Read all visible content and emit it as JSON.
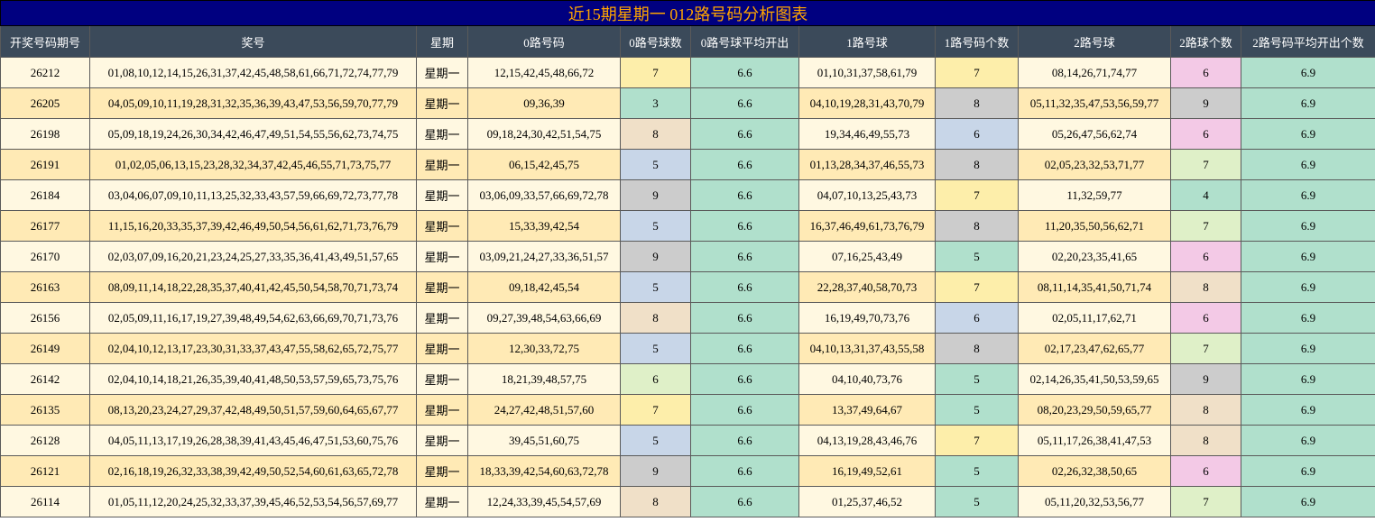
{
  "title": "近15期星期一 012路号码分析图表",
  "headers": [
    "开奖号码期号",
    "奖号",
    "星期",
    "0路号码",
    "0路号球数",
    "0路号球平均开出",
    "1路号球",
    "1路号码个数",
    "2路号球",
    "2路球个数",
    "2路号码平均开出个数"
  ],
  "colors": {
    "7": "#fdeeaa",
    "3": "#b0e0cc",
    "8": "#f0e0c8",
    "5": "#c8d6e8",
    "9": "#cccccc",
    "6": "#dff0c8",
    "4": "#b0e0cc",
    "avg": "#b0e0cc"
  },
  "rows": [
    {
      "issue": "26212",
      "numbers": "01,08,10,12,14,15,26,31,37,42,45,48,58,61,66,71,72,74,77,79",
      "weekday": "星期一",
      "r0": "12,15,42,45,48,66,72",
      "r0n": "7",
      "r0avg": "6.6",
      "r1": "01,10,31,37,58,61,79",
      "r1n": "7",
      "r2": "08,14,26,71,74,77",
      "r2n": "6",
      "r2avg": "6.9",
      "c0": "#fdeeaa",
      "c1": "#fdeeaa",
      "c2": "#f3c9e6"
    },
    {
      "issue": "26205",
      "numbers": "04,05,09,10,11,19,28,31,32,35,36,39,43,47,53,56,59,70,77,79",
      "weekday": "星期一",
      "r0": "09,36,39",
      "r0n": "3",
      "r0avg": "6.6",
      "r1": "04,10,19,28,31,43,70,79",
      "r1n": "8",
      "r2": "05,11,32,35,47,53,56,59,77",
      "r2n": "9",
      "r2avg": "6.9",
      "c0": "#b0e0cc",
      "c1": "#cccccc",
      "c2": "#cccccc"
    },
    {
      "issue": "26198",
      "numbers": "05,09,18,19,24,26,30,34,42,46,47,49,51,54,55,56,62,73,74,75",
      "weekday": "星期一",
      "r0": "09,18,24,30,42,51,54,75",
      "r0n": "8",
      "r0avg": "6.6",
      "r1": "19,34,46,49,55,73",
      "r1n": "6",
      "r2": "05,26,47,56,62,74",
      "r2n": "6",
      "r2avg": "6.9",
      "c0": "#f0e0c8",
      "c1": "#c8d6e8",
      "c2": "#f3c9e6"
    },
    {
      "issue": "26191",
      "numbers": "01,02,05,06,13,15,23,28,32,34,37,42,45,46,55,71,73,75,77",
      "weekday": "星期一",
      "r0": "06,15,42,45,75",
      "r0n": "5",
      "r0avg": "6.6",
      "r1": "01,13,28,34,37,46,55,73",
      "r1n": "8",
      "r2": "02,05,23,32,53,71,77",
      "r2n": "7",
      "r2avg": "6.9",
      "c0": "#c8d6e8",
      "c1": "#cccccc",
      "c2": "#dff0c8"
    },
    {
      "issue": "26184",
      "numbers": "03,04,06,07,09,10,11,13,25,32,33,43,57,59,66,69,72,73,77,78",
      "weekday": "星期一",
      "r0": "03,06,09,33,57,66,69,72,78",
      "r0n": "9",
      "r0avg": "6.6",
      "r1": "04,07,10,13,25,43,73",
      "r1n": "7",
      "r2": "11,32,59,77",
      "r2n": "4",
      "r2avg": "6.9",
      "c0": "#cccccc",
      "c1": "#fdeeaa",
      "c2": "#b0e0cc"
    },
    {
      "issue": "26177",
      "numbers": "11,15,16,20,33,35,37,39,42,46,49,50,54,56,61,62,71,73,76,79",
      "weekday": "星期一",
      "r0": "15,33,39,42,54",
      "r0n": "5",
      "r0avg": "6.6",
      "r1": "16,37,46,49,61,73,76,79",
      "r1n": "8",
      "r2": "11,20,35,50,56,62,71",
      "r2n": "7",
      "r2avg": "6.9",
      "c0": "#c8d6e8",
      "c1": "#cccccc",
      "c2": "#dff0c8"
    },
    {
      "issue": "26170",
      "numbers": "02,03,07,09,16,20,21,23,24,25,27,33,35,36,41,43,49,51,57,65",
      "weekday": "星期一",
      "r0": "03,09,21,24,27,33,36,51,57",
      "r0n": "9",
      "r0avg": "6.6",
      "r1": "07,16,25,43,49",
      "r1n": "5",
      "r2": "02,20,23,35,41,65",
      "r2n": "6",
      "r2avg": "6.9",
      "c0": "#cccccc",
      "c1": "#b0e0cc",
      "c2": "#f3c9e6"
    },
    {
      "issue": "26163",
      "numbers": "08,09,11,14,18,22,28,35,37,40,41,42,45,50,54,58,70,71,73,74",
      "weekday": "星期一",
      "r0": "09,18,42,45,54",
      "r0n": "5",
      "r0avg": "6.6",
      "r1": "22,28,37,40,58,70,73",
      "r1n": "7",
      "r2": "08,11,14,35,41,50,71,74",
      "r2n": "8",
      "r2avg": "6.9",
      "c0": "#c8d6e8",
      "c1": "#fdeeaa",
      "c2": "#f0e0c8"
    },
    {
      "issue": "26156",
      "numbers": "02,05,09,11,16,17,19,27,39,48,49,54,62,63,66,69,70,71,73,76",
      "weekday": "星期一",
      "r0": "09,27,39,48,54,63,66,69",
      "r0n": "8",
      "r0avg": "6.6",
      "r1": "16,19,49,70,73,76",
      "r1n": "6",
      "r2": "02,05,11,17,62,71",
      "r2n": "6",
      "r2avg": "6.9",
      "c0": "#f0e0c8",
      "c1": "#c8d6e8",
      "c2": "#f3c9e6"
    },
    {
      "issue": "26149",
      "numbers": "02,04,10,12,13,17,23,30,31,33,37,43,47,55,58,62,65,72,75,77",
      "weekday": "星期一",
      "r0": "12,30,33,72,75",
      "r0n": "5",
      "r0avg": "6.6",
      "r1": "04,10,13,31,37,43,55,58",
      "r1n": "8",
      "r2": "02,17,23,47,62,65,77",
      "r2n": "7",
      "r2avg": "6.9",
      "c0": "#c8d6e8",
      "c1": "#cccccc",
      "c2": "#dff0c8"
    },
    {
      "issue": "26142",
      "numbers": "02,04,10,14,18,21,26,35,39,40,41,48,50,53,57,59,65,73,75,76",
      "weekday": "星期一",
      "r0": "18,21,39,48,57,75",
      "r0n": "6",
      "r0avg": "6.6",
      "r1": "04,10,40,73,76",
      "r1n": "5",
      "r2": "02,14,26,35,41,50,53,59,65",
      "r2n": "9",
      "r2avg": "6.9",
      "c0": "#dff0c8",
      "c1": "#b0e0cc",
      "c2": "#cccccc"
    },
    {
      "issue": "26135",
      "numbers": "08,13,20,23,24,27,29,37,42,48,49,50,51,57,59,60,64,65,67,77",
      "weekday": "星期一",
      "r0": "24,27,42,48,51,57,60",
      "r0n": "7",
      "r0avg": "6.6",
      "r1": "13,37,49,64,67",
      "r1n": "5",
      "r2": "08,20,23,29,50,59,65,77",
      "r2n": "8",
      "r2avg": "6.9",
      "c0": "#fdeeaa",
      "c1": "#b0e0cc",
      "c2": "#f0e0c8"
    },
    {
      "issue": "26128",
      "numbers": "04,05,11,13,17,19,26,28,38,39,41,43,45,46,47,51,53,60,75,76",
      "weekday": "星期一",
      "r0": "39,45,51,60,75",
      "r0n": "5",
      "r0avg": "6.6",
      "r1": "04,13,19,28,43,46,76",
      "r1n": "7",
      "r2": "05,11,17,26,38,41,47,53",
      "r2n": "8",
      "r2avg": "6.9",
      "c0": "#c8d6e8",
      "c1": "#fdeeaa",
      "c2": "#f0e0c8"
    },
    {
      "issue": "26121",
      "numbers": "02,16,18,19,26,32,33,38,39,42,49,50,52,54,60,61,63,65,72,78",
      "weekday": "星期一",
      "r0": "18,33,39,42,54,60,63,72,78",
      "r0n": "9",
      "r0avg": "6.6",
      "r1": "16,19,49,52,61",
      "r1n": "5",
      "r2": "02,26,32,38,50,65",
      "r2n": "6",
      "r2avg": "6.9",
      "c0": "#cccccc",
      "c1": "#b0e0cc",
      "c2": "#f3c9e6"
    },
    {
      "issue": "26114",
      "numbers": "01,05,11,12,20,24,25,32,33,37,39,45,46,52,53,54,56,57,69,77",
      "weekday": "星期一",
      "r0": "12,24,33,39,45,54,57,69",
      "r0n": "8",
      "r0avg": "6.6",
      "r1": "01,25,37,46,52",
      "r1n": "5",
      "r2": "05,11,20,32,53,56,77",
      "r2n": "7",
      "r2avg": "6.9",
      "c0": "#f0e0c8",
      "c1": "#b0e0cc",
      "c2": "#dff0c8"
    }
  ]
}
